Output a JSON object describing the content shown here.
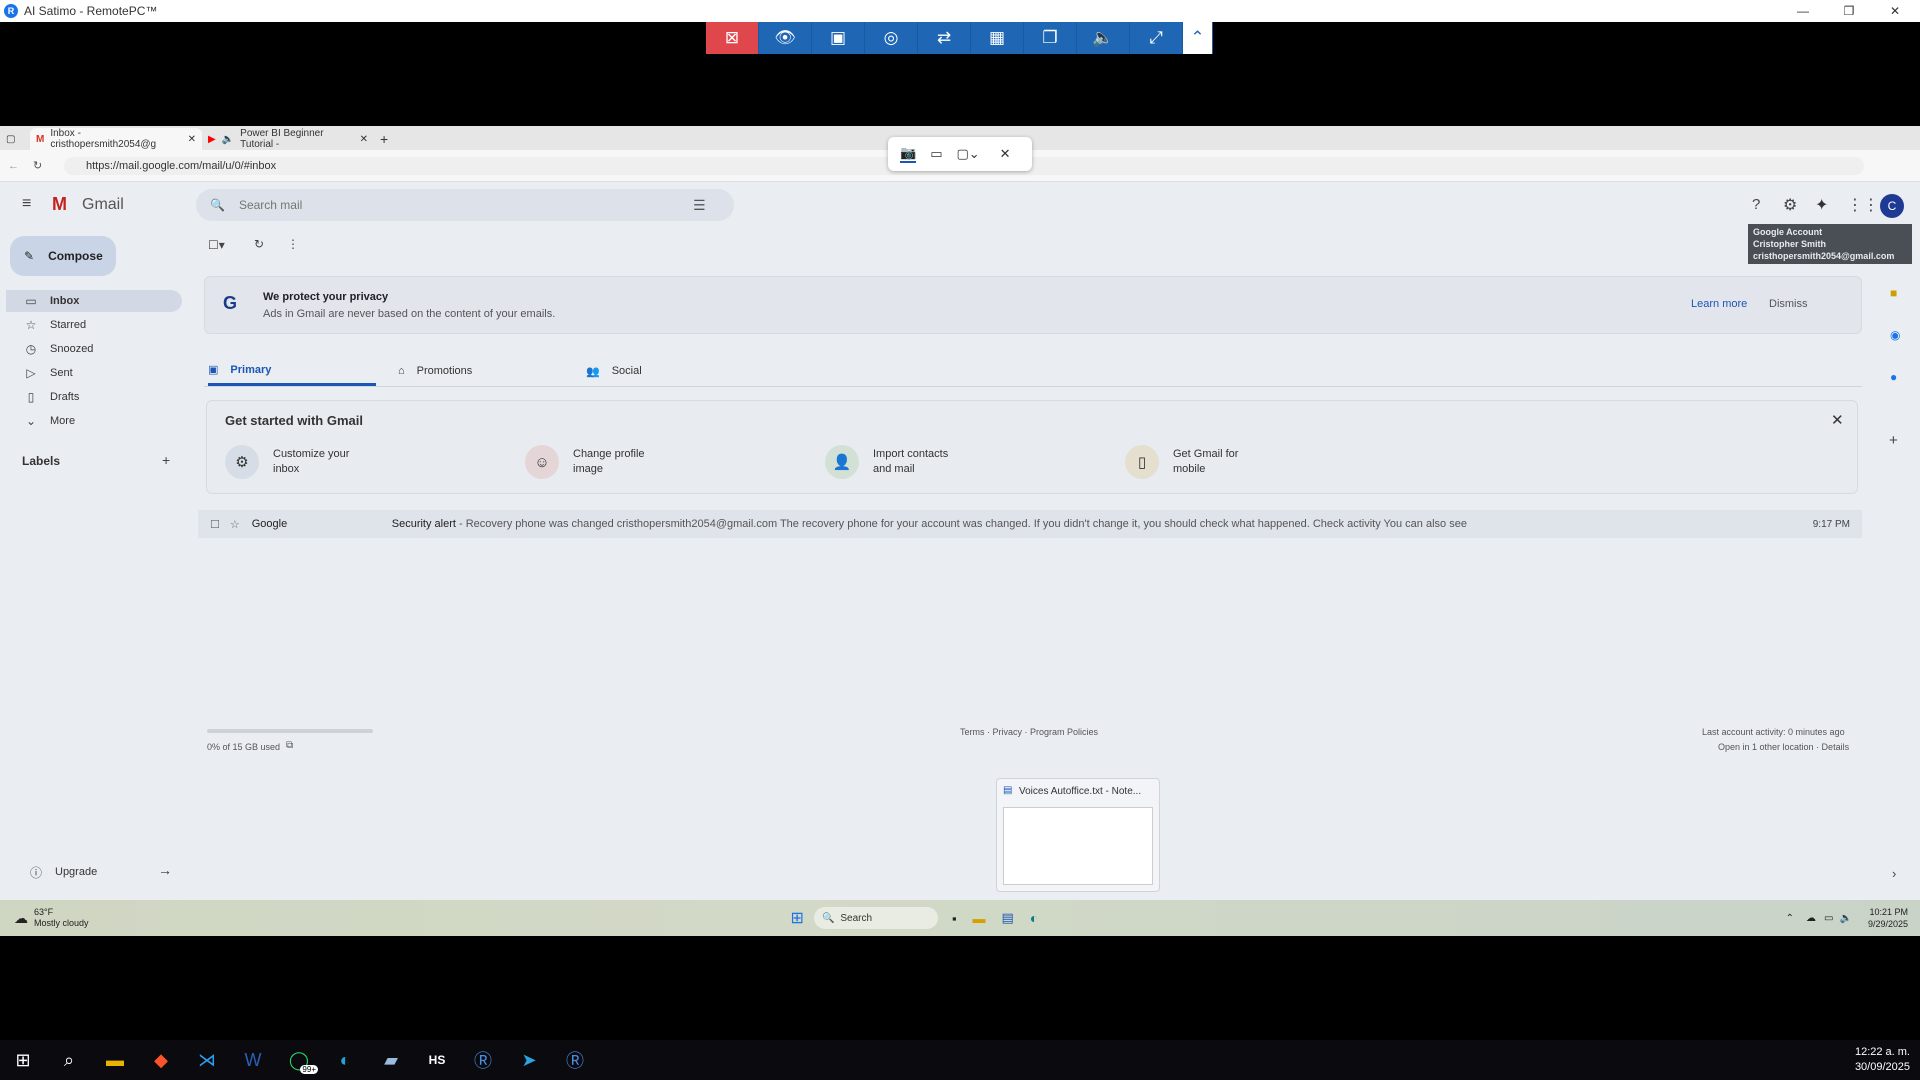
{
  "rp_window": {
    "title": "AI Satimo - RemotePC™",
    "minimize": "—",
    "restore": "❐",
    "close": "✕"
  },
  "rp_toolbar": {
    "icons": [
      "disconnect-icon",
      "view-icon",
      "toolbox-icon",
      "performance-icon",
      "transfer-icon",
      "apps-icon",
      "screens-icon",
      "audio-icon",
      "fullscreen-icon",
      "collapse-icon"
    ]
  },
  "browser": {
    "tabs": [
      {
        "label": "Inbox - cristhopersmith2054@g"
      },
      {
        "label": "Power BI Beginner Tutorial -"
      }
    ],
    "url": "https://mail.google.com/mail/u/0/#inbox"
  },
  "snip": {
    "close": "✕"
  },
  "gmail": {
    "brand": "Gmail",
    "compose": "Compose",
    "search_placeholder": "Search mail",
    "sidebar": [
      {
        "label": "Inbox",
        "icon": "inbox-icon"
      },
      {
        "label": "Starred",
        "icon": "star-icon"
      },
      {
        "label": "Snoozed",
        "icon": "clock-icon"
      },
      {
        "label": "Sent",
        "icon": "send-icon"
      },
      {
        "label": "Drafts",
        "icon": "draft-icon"
      },
      {
        "label": "More",
        "icon": "chevron-down-icon"
      }
    ],
    "labels_heading": "Labels",
    "upgrade": "Upgrade",
    "account_initial": "C",
    "tooltip": {
      "line1": "Google Account",
      "line2": "Cristopher Smith",
      "line3": "cristhopersmith2054@gmail.com"
    },
    "privacy": {
      "title": "We protect your privacy",
      "body": "Ads in Gmail are never based on the content of your emails.",
      "learn_more": "Learn more",
      "dismiss": "Dismiss"
    },
    "tabs": [
      {
        "label": "Primary"
      },
      {
        "label": "Promotions"
      },
      {
        "label": "Social"
      }
    ],
    "get_started": {
      "title": "Get started with Gmail",
      "items": [
        {
          "line1": "Customize your",
          "line2": "inbox"
        },
        {
          "line1": "Change profile",
          "line2": "image"
        },
        {
          "line1": "Import contacts",
          "line2": "and mail"
        },
        {
          "line1": "Get Gmail for",
          "line2": "mobile"
        }
      ]
    },
    "mail": {
      "sender": "Google",
      "subject": "Security alert",
      "snippet": " - Recovery phone was changed cristhopersmith2054@gmail.com The recovery phone for your account was changed. If you didn't change it, you should check what happened. Check activity You can also see",
      "time": "9:17 PM"
    },
    "storage": "0% of 15 GB used",
    "storage_fraction": 0.0,
    "footer_links": "Terms · Privacy · Program Policies",
    "activity_line1": "Last account activity: 0 minutes ago",
    "activity_line2": "Open in 1 other location · Details"
  },
  "preview": {
    "title": "Voices Autoffice.txt - Note..."
  },
  "remote_taskbar": {
    "temp": "63°F",
    "weather": "Mostly cloudy",
    "search": "Search",
    "time": "10:21 PM",
    "date": "9/29/2025"
  },
  "local_taskbar": {
    "time": "12:22 a. m.",
    "date": "30/09/2025",
    "whatsapp_badge": "99+"
  }
}
